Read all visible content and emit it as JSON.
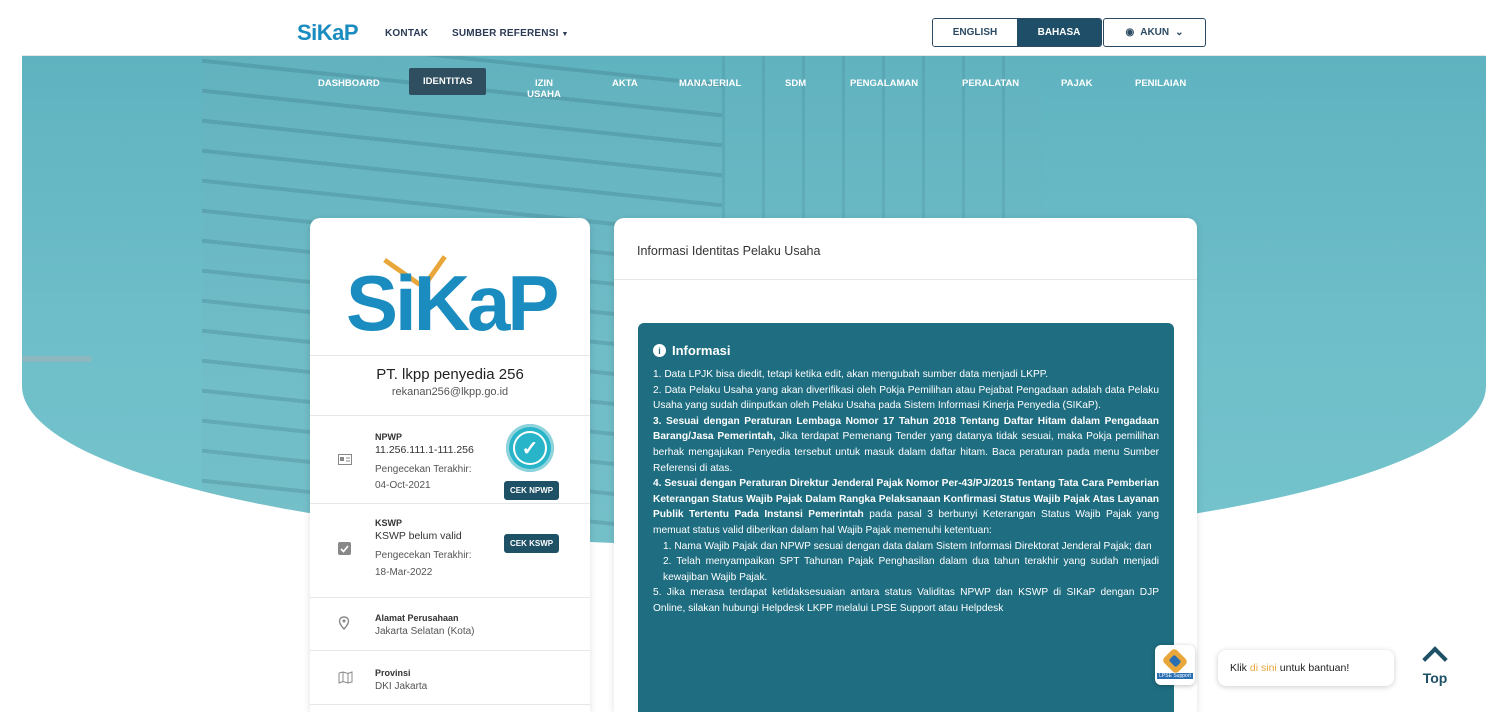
{
  "topbar": {
    "logo": "SiKaP",
    "links": [
      "KONTAK",
      "SUMBER REFERENSI"
    ],
    "lang_en": "ENGLISH",
    "lang_id": "BAHASA",
    "akun": "AKUN"
  },
  "menu": [
    "DASHBOARD",
    "IDENTITAS",
    "IZIN USAHA",
    "AKTA",
    "MANAJERIAL",
    "SDM",
    "PENGALAMAN",
    "PERALATAN",
    "PAJAK",
    "PENILAIAN"
  ],
  "active_menu": "IDENTITAS",
  "profile": {
    "logo": "SiKaP",
    "name": "PT. lkpp penyedia 256",
    "email": "rekanan256@lkpp.go.id",
    "npwp_label": "NPWP",
    "npwp_value": "11.256.111.1-111.256",
    "npwp_check_label": "Pengecekan Terakhir:",
    "npwp_check_date": "04-Oct-2021",
    "npwp_button": "CEK NPWP",
    "kswp_label": "KSWP",
    "kswp_value": "KSWP belum valid",
    "kswp_check_label": "Pengecekan Terakhir:",
    "kswp_check_date": "18-Mar-2022",
    "kswp_button": "CEK KSWP",
    "alamat_label": "Alamat Perusahaan",
    "alamat_value": "Jakarta Selatan (Kota)",
    "provinsi_label": "Provinsi",
    "provinsi_value": "DKI Jakarta"
  },
  "content": {
    "title": "Informasi Identitas Pelaku Usaha",
    "info_heading": "Informasi",
    "p1": "1. Data LPJK bisa diedit, tetapi ketika edit, akan mengubah sumber data menjadi LKPP.",
    "p2": "2. Data Pelaku Usaha yang akan diverifikasi oleh Pokja Pemilihan atau Pejabat Pengadaan adalah data Pelaku Usaha yang sudah diinputkan oleh Pelaku Usaha pada Sistem Informasi Kinerja Penyedia (SIKaP).",
    "p3_bold": "3. Sesuai dengan Peraturan Lembaga Nomor 17 Tahun 2018 Tentang Daftar Hitam dalam Pengadaan Barang/Jasa Pemerintah,",
    "p3_rest": " Jika terdapat Pemenang Tender yang datanya tidak sesuai, maka Pokja pemilihan berhak mengajukan Penyedia tersebut untuk masuk dalam daftar hitam. Baca peraturan pada menu Sumber Referensi di atas.",
    "p4_bold": "4. Sesuai dengan Peraturan Direktur Jenderal Pajak Nomor Per-43/PJ/2015 Tentang Tata Cara Pemberian Keterangan Status Wajib Pajak Dalam Rangka Pelaksanaan Konfirmasi Status Wajib Pajak Atas Layanan Publik Tertentu Pada Instansi Pemerintah",
    "p4_rest": " pada pasal 3 berbunyi Keterangan Status Wajib Pajak yang memuat status valid diberikan dalam hal Wajib Pajak memenuhi ketentuan:",
    "p4_1": "1. Nama Wajib Pajak dan NPWP sesuai dengan data dalam Sistem Informasi Direktorat Jenderal Pajak; dan",
    "p4_2": "2. Telah menyampaikan SPT Tahunan Pajak Penghasilan dalam dua tahun terakhir yang sudah menjadi kewajiban Wajib Pajak.",
    "p5": "5. Jika merasa terdapat ketidaksesuaian antara status Validitas NPWP dan KSWP di SIKaP dengan DJP Online, silakan hubungi Helpdesk LKPP melalui LPSE Support atau Helpdesk"
  },
  "support": {
    "lpse_label": "LPSE Support",
    "bubble_pre": "Klik",
    "bubble_link": "di sini",
    "bubble_post": "untuk bantuan!",
    "top": "Top"
  }
}
